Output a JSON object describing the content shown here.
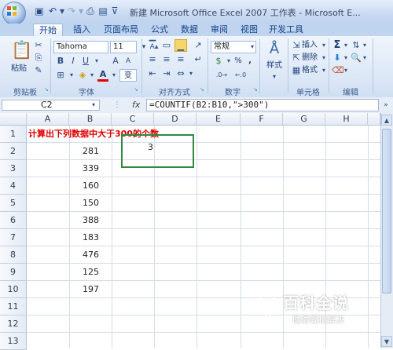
{
  "title_bar": {
    "title": "新建 Microsoft Office Excel 2007 工作表 - Microsoft E..."
  },
  "tabs": [
    "开始",
    "插入",
    "页面布局",
    "公式",
    "数据",
    "审阅",
    "视图",
    "开发工具"
  ],
  "ribbon": {
    "clipboard": {
      "label": "剪贴板",
      "paste": "粘贴"
    },
    "font": {
      "label": "字体",
      "name": "Tahoma",
      "size": "11"
    },
    "alignment": {
      "label": "对齐方式",
      "wrap_symbol": "变"
    },
    "number": {
      "label": "数字",
      "format": "常规",
      "percent": "%",
      "comma": ","
    },
    "styles": {
      "label": "样式"
    },
    "cells": {
      "label": "单元格",
      "insert": "插入",
      "delete": "删除",
      "format": "格式"
    },
    "editing": {
      "label": "编辑",
      "sum_symbol": "Σ"
    }
  },
  "formula_bar": {
    "name_box": "C2",
    "fx": "fx",
    "formula": "=COUNTIF(B2:B10,\">300\")"
  },
  "sheet": {
    "columns": [
      "A",
      "B",
      "C",
      "D",
      "E",
      "F",
      "G",
      "H"
    ],
    "rows": [
      "1",
      "2",
      "3",
      "4",
      "5",
      "6",
      "7",
      "8",
      "9",
      "10",
      "11",
      "12",
      "13"
    ],
    "heading": "计算出下列数据中大于300的个数",
    "values": [
      "281",
      "339",
      "160",
      "150",
      "388",
      "183",
      "476",
      "125",
      "197"
    ],
    "result": "3"
  },
  "watermark": {
    "main": "百科全说",
    "sub": "助你轻松解决"
  },
  "colors": {
    "heading_red": "#e00000",
    "selection_green": "#2f8a3e",
    "ribbon_blue": "#dbe7f6"
  }
}
